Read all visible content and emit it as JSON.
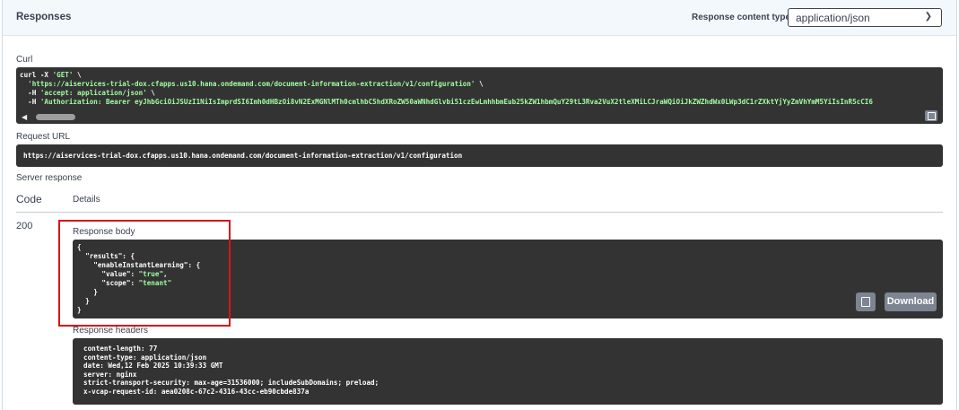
{
  "header": {
    "title": "Responses",
    "content_type_label": "Response content type",
    "content_type_value": "application/json"
  },
  "curl": {
    "label": "Curl",
    "line1_cmd": "curl -X ",
    "line1_method": "'GET'",
    "line1_tail": " \\",
    "line2_url": "'https://aiservices-trial-dox.cfapps.us10.hana.ondemand.com/document-information-extraction/v1/configuration'",
    "line2_tail": " \\",
    "line3_flag": "  -H ",
    "line3_val": "'accept: application/json'",
    "line3_tail": " \\",
    "line4_flag": "  -H ",
    "line4_val": "'Authorization: Bearer eyJhbGciOiJSUzI1NiIsImprdSI6Imh0dHBzOi8vN2ExMGNlMTh0cmlhbC5hdXRoZW50aWNhdGlvbi51czEwLmhhbmEub25kZW1hbmQuY29tL3Rva2VuX2tleXMiLCJraWQiOiJkZWZhdWx0LWp3dC1rZXktYjYyZmVhYmM5YiIsInR5cCI6"
  },
  "request_url": {
    "label": "Request URL",
    "value": "https://aiservices-trial-dox.cfapps.us10.hana.ondemand.com/document-information-extraction/v1/configuration"
  },
  "server_response": {
    "label": "Server response",
    "code_header": "Code",
    "details_header": "Details",
    "status_code": "200",
    "body_label": "Response body",
    "body_lines": {
      "l1": "{",
      "l2_key": "  \"results\"",
      "l2_rest": ": {",
      "l3_key": "    \"enableInstantLearning\"",
      "l3_rest": ": {",
      "l4_key": "      \"value\"",
      "l4_sep": ": ",
      "l4_val": "\"true\"",
      "l4_end": ",",
      "l5_key": "      \"scope\"",
      "l5_sep": ": ",
      "l5_val": "\"tenant\"",
      "l6": "    }",
      "l7": "  }",
      "l8": "}"
    },
    "download_label": "Download",
    "headers_label": "Response headers",
    "headers": [
      "content-length: 77",
      "content-type: application/json",
      "date: Wed,12 Feb 2025 10:39:33 GMT",
      "server: nginx",
      "strict-transport-security: max-age=31536000; includeSubDomains; preload;",
      "x-vcap-request-id: aea0208c-67c2-4316-43cc-eb90cbde837a"
    ]
  },
  "colors": {
    "code_bg": "#333333",
    "string_green": "#a2fca2",
    "highlight_red": "#d9121a",
    "button_grey": "#7d8492"
  }
}
